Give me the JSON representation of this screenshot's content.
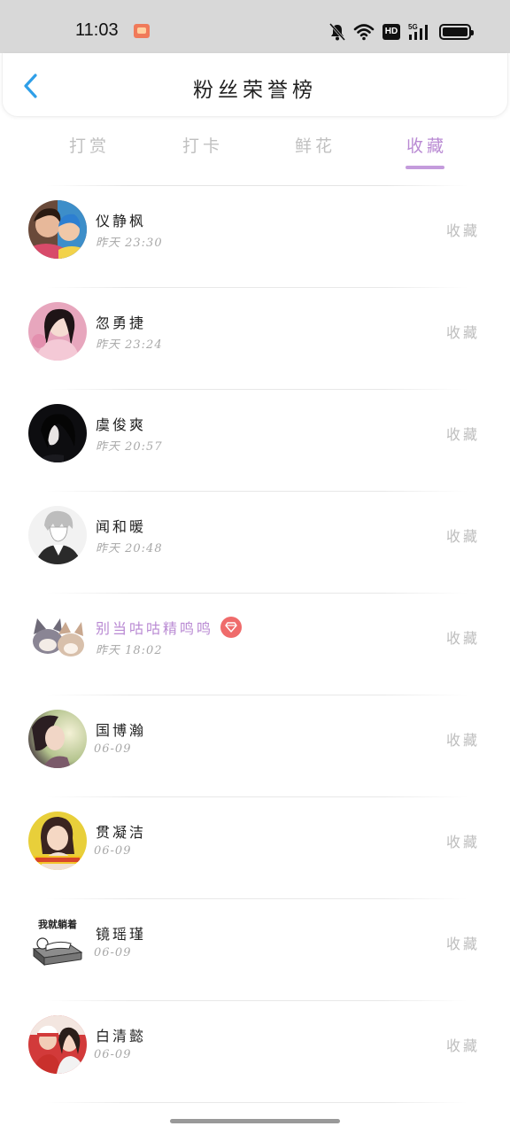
{
  "status_bar": {
    "time": "11:03",
    "icons": [
      "app-notification-icon",
      "bell-muted-icon",
      "wifi-icon",
      "hd-icon",
      "5g-signal-icon",
      "battery-icon"
    ],
    "hd_label": "HD",
    "network_label": "5G"
  },
  "header": {
    "title": "粉丝荣誉榜",
    "back_icon": "chevron-left-icon"
  },
  "tabs": [
    {
      "label": "打赏",
      "active": false
    },
    {
      "label": "打卡",
      "active": false
    },
    {
      "label": "鲜花",
      "active": false
    },
    {
      "label": "收藏",
      "active": true
    }
  ],
  "colors": {
    "accent": "#b98ad3",
    "accent_underline": "#c49bdc",
    "back_icon": "#2f9fe8",
    "vip_badge": "#ef6b6b",
    "muted_text": "#a8a8a8"
  },
  "fans": [
    {
      "name": "仪静枫",
      "time": "昨天 23:30",
      "action": "收藏",
      "vip": false
    },
    {
      "name": "忽勇捷",
      "time": "昨天 23:24",
      "action": "收藏",
      "vip": false
    },
    {
      "name": "虞俊爽",
      "time": "昨天 20:57",
      "action": "收藏",
      "vip": false
    },
    {
      "name": "闻和暖",
      "time": "昨天 20:48",
      "action": "收藏",
      "vip": false
    },
    {
      "name": "别当咕咕精鸣鸣",
      "time": "昨天 18:02",
      "action": "收藏",
      "vip": true
    },
    {
      "name": "国博瀚",
      "time": "06-09",
      "action": "收藏",
      "vip": false
    },
    {
      "name": "贯凝洁",
      "time": "06-09",
      "action": "收藏",
      "vip": false
    },
    {
      "name": "镜瑶瑾",
      "time": "06-09",
      "action": "收藏",
      "vip": false,
      "avatar_caption": "我就躺着"
    },
    {
      "name": "白清懿",
      "time": "06-09",
      "action": "收藏",
      "vip": false
    }
  ]
}
